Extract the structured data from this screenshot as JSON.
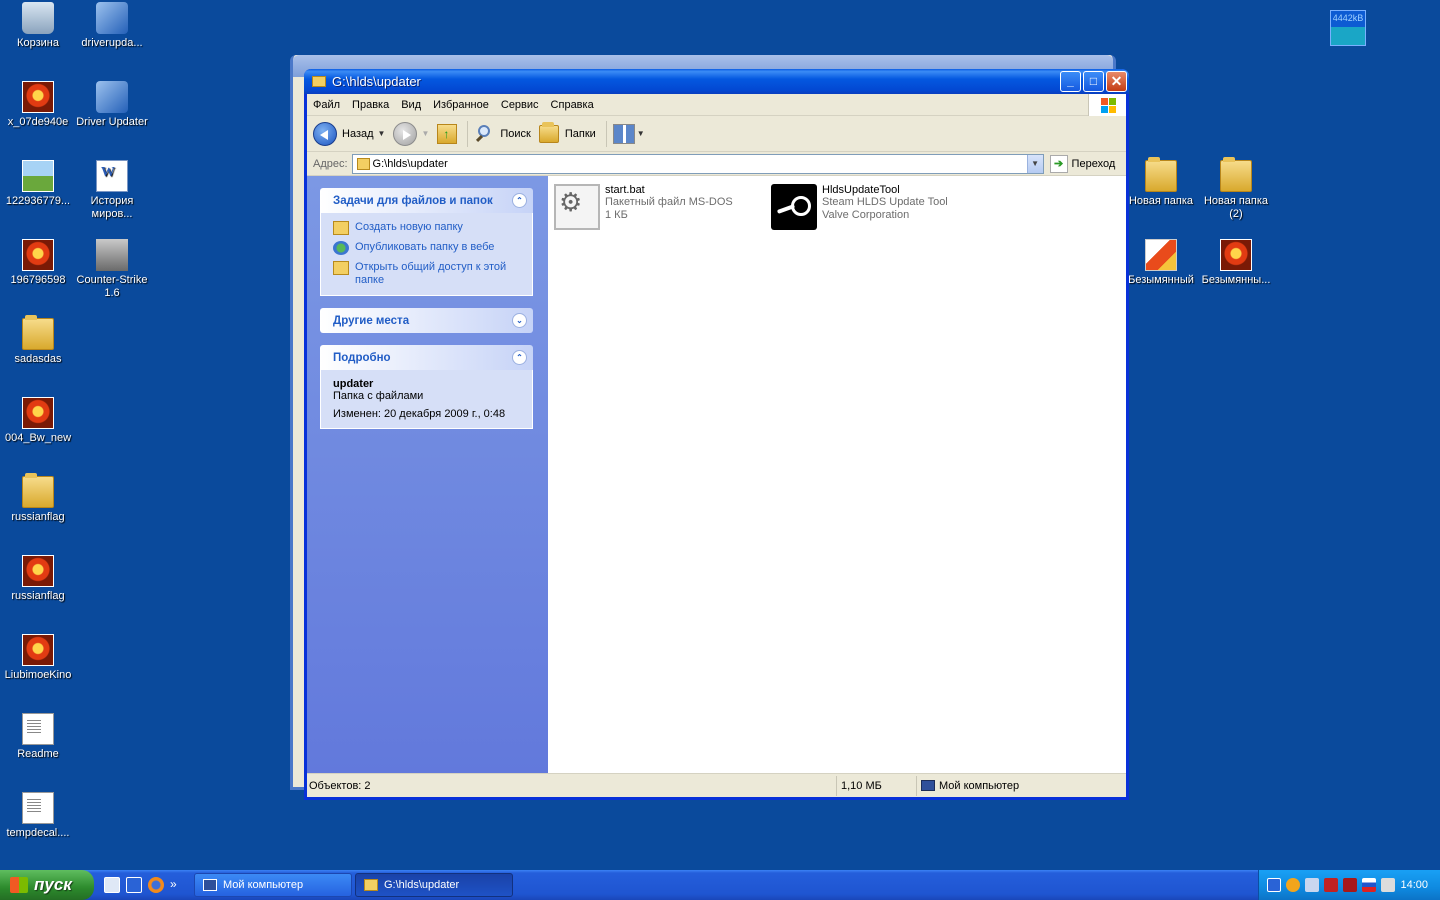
{
  "desktop": {
    "left_icons": [
      {
        "label": "Корзина",
        "icon": "recycle-bin-icon"
      },
      {
        "label": "driverupda...",
        "icon": "app-icon"
      },
      {
        "label": "x_07de940e",
        "icon": "photo-icon"
      },
      {
        "label": "Driver Updater",
        "icon": "app-icon"
      },
      {
        "label": "122936779...",
        "icon": "image-icon"
      },
      {
        "label": "История миров...",
        "icon": "word-doc-icon"
      },
      {
        "label": "196796598",
        "icon": "photo-icon"
      },
      {
        "label": "Counter-Strike 1.6",
        "icon": "cs-icon"
      },
      {
        "label": "sadasdas",
        "icon": "folder-icon"
      },
      {
        "label": "004_Bw_new",
        "icon": "photo-icon"
      },
      {
        "label": "russianflag",
        "icon": "folder-icon"
      },
      {
        "label": "russianflag",
        "icon": "photo-icon"
      },
      {
        "label": "LiubimoeKino",
        "icon": "photo-icon"
      },
      {
        "label": "Readme",
        "icon": "text-doc-icon"
      },
      {
        "label": "tempdecal....",
        "icon": "blank-doc-icon"
      }
    ],
    "right_icons": [
      {
        "label": "Новая папка",
        "icon": "folder-icon"
      },
      {
        "label": "Новая папка (2)",
        "icon": "folder-icon"
      },
      {
        "label": "Безымянный",
        "icon": "paint-icon"
      },
      {
        "label": "Безымянны...",
        "icon": "photo-icon"
      }
    ],
    "net_meter": "4442kB"
  },
  "window": {
    "title": "G:\\hlds\\updater",
    "menu": [
      "Файл",
      "Правка",
      "Вид",
      "Избранное",
      "Сервис",
      "Справка"
    ],
    "toolbar": {
      "back": "Назад",
      "search": "Поиск",
      "folders": "Папки"
    },
    "address": {
      "label": "Адрес:",
      "value": "G:\\hlds\\updater",
      "go": "Переход"
    },
    "tasks_panel": {
      "title": "Задачи для файлов и папок",
      "items": [
        "Создать новую папку",
        "Опубликовать папку в вебе",
        "Открыть общий доступ к этой папке"
      ]
    },
    "other_places": {
      "title": "Другие места"
    },
    "details": {
      "title": "Подробно",
      "name": "updater",
      "type": "Папка с файлами",
      "modified": "Изменен: 20 декабря 2009 г., 0:48"
    },
    "files": [
      {
        "name": "start.bat",
        "line2": "Пакетный файл MS-DOS",
        "line3": "1 КБ",
        "icon": "batch-file-icon"
      },
      {
        "name": "HldsUpdateTool",
        "line2": "Steam HLDS Update Tool",
        "line3": "Valve Corporation",
        "icon": "steam-icon"
      }
    ],
    "status": {
      "objects": "Объектов: 2",
      "size": "1,10 МБ",
      "location": "Мой компьютер"
    }
  },
  "taskbar": {
    "start": "пуск",
    "more": "»",
    "tasks": [
      {
        "label": "Мой компьютер",
        "active": false
      },
      {
        "label": "G:\\hlds\\updater",
        "active": true
      }
    ],
    "clock": "14:00"
  }
}
